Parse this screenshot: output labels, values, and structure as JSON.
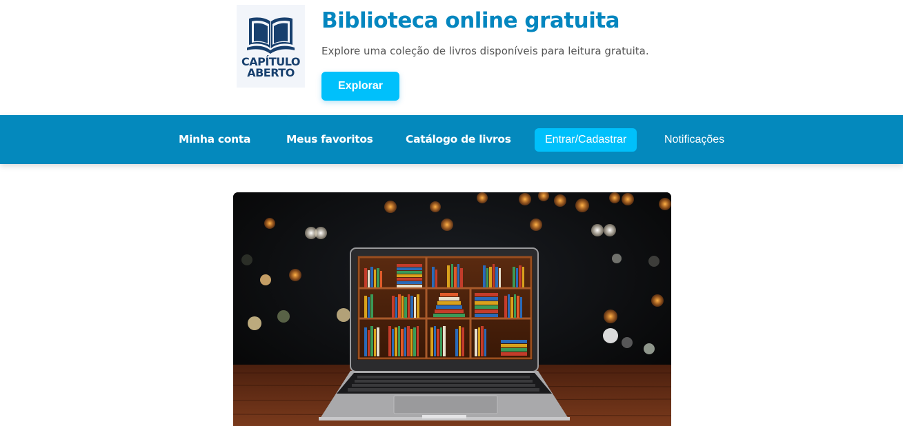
{
  "header": {
    "logo": {
      "line1": "CAPÍTULO",
      "line2": "ABERTO",
      "icon": "open-book-icon"
    },
    "title": "Biblioteca online gratuita",
    "subtitle": "Explore uma coleção de livros disponíveis para leitura gratuita.",
    "explore_label": "Explorar"
  },
  "nav": {
    "items": [
      {
        "label": "Minha conta"
      },
      {
        "label": "Meus favoritos"
      },
      {
        "label": "Catálogo de livros"
      },
      {
        "label": "Entrar/Cadastrar",
        "active": true
      },
      {
        "label": "Notificações"
      }
    ]
  },
  "colors": {
    "brand": "#0486bf",
    "nav_bg": "#0489bd",
    "accent": "#00c0fb",
    "logo_text": "#18406e"
  },
  "hero": {
    "description": "Laptop displaying a bookshelf on a wooden table with bokeh lights"
  }
}
